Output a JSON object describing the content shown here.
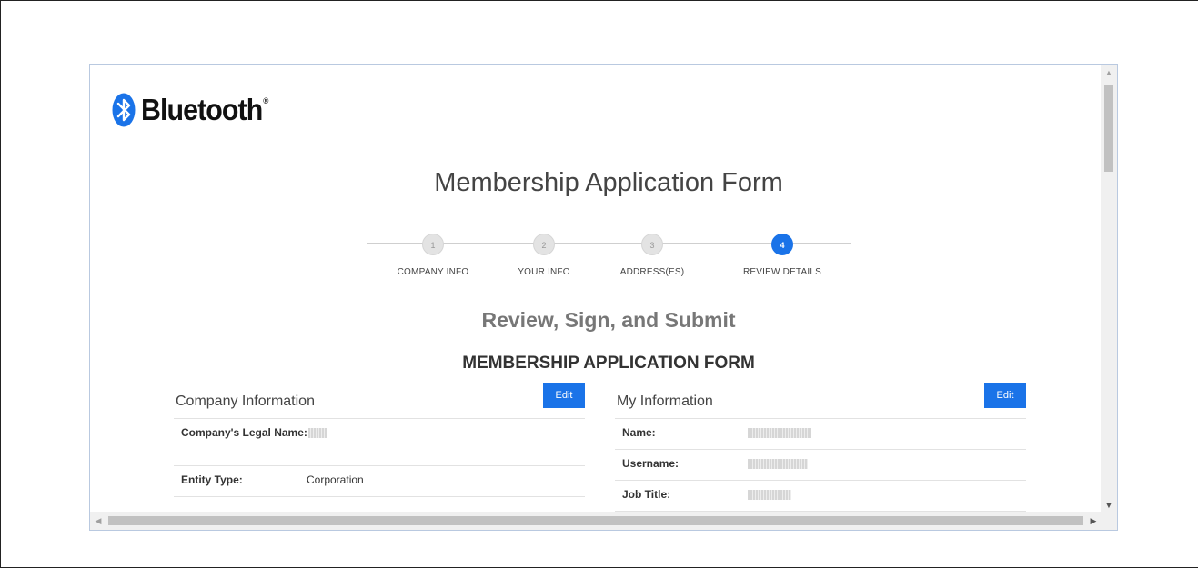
{
  "brand": {
    "name": "Bluetooth",
    "reg_mark": "®"
  },
  "page": {
    "title": "Membership Application Form",
    "section_title": "Review, Sign, and Submit",
    "form_title": "MEMBERSHIP APPLICATION FORM"
  },
  "steps": [
    {
      "number": "1",
      "label": "COMPANY INFO",
      "active": false
    },
    {
      "number": "2",
      "label": "YOUR INFO",
      "active": false
    },
    {
      "number": "3",
      "label": "ADDRESS(ES)",
      "active": false
    },
    {
      "number": "4",
      "label": "REVIEW DETAILS",
      "active": true
    }
  ],
  "company_panel": {
    "title": "Company Information",
    "edit_label": "Edit",
    "rows": [
      {
        "label": "Company's Legal Name:",
        "value": "",
        "redacted": true
      },
      {
        "label": "Entity Type:",
        "value": "Corporation",
        "redacted": false
      }
    ]
  },
  "my_panel": {
    "title": "My Information",
    "edit_label": "Edit",
    "rows": [
      {
        "label": "Name:",
        "value": "",
        "redacted": true
      },
      {
        "label": "Username:",
        "value": "",
        "redacted": true
      },
      {
        "label": "Job Title:",
        "value": "",
        "redacted": true
      }
    ]
  },
  "colors": {
    "accent": "#1a73e8",
    "inactive_step": "#e3e3e3",
    "window_border": "#b9c9e0"
  }
}
